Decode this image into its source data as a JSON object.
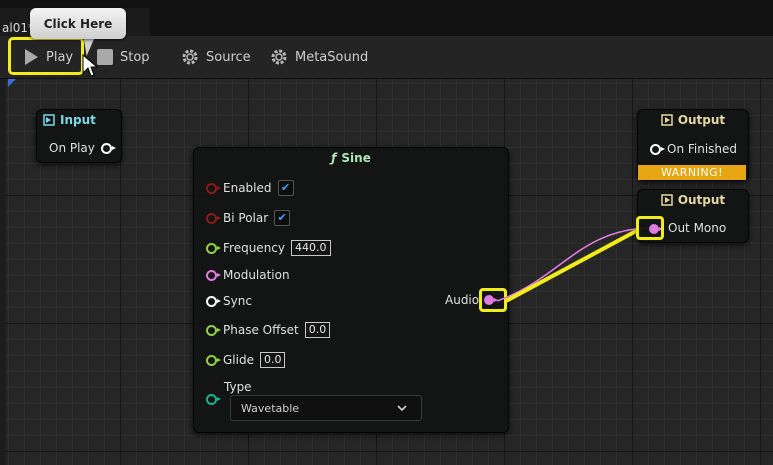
{
  "tab": {
    "title": "al01*"
  },
  "tooltip": {
    "text": "Click Here"
  },
  "toolbar": {
    "play": "Play",
    "stop": "Stop",
    "source": "Source",
    "metasound": "MetaSound"
  },
  "nodes": {
    "input": {
      "title": "Input",
      "pin": "On Play"
    },
    "sine": {
      "title": "Sine",
      "enabled": "Enabled",
      "bipolar": "Bi Polar",
      "frequency": "Frequency",
      "frequency_value": "440.0",
      "modulation": "Modulation",
      "sync": "Sync",
      "phase_offset": "Phase Offset",
      "phase_offset_value": "0.0",
      "glide": "Glide",
      "glide_value": "0.0",
      "type": "Type",
      "type_value": "Wavetable",
      "audio": "Audio"
    },
    "output_finished": {
      "title": "Output",
      "pin": "On Finished",
      "warning": "WARNING!"
    },
    "output_mono": {
      "title": "Output",
      "pin": "Out Mono"
    }
  },
  "colors": {
    "highlight": "#f2ec1a",
    "audio_pin": "#e07be0",
    "trigger_pin": "#ffffff",
    "float_pin": "#8fd14a",
    "bool_pin": "#8b1a1a",
    "enum_pin": "#1ab38c",
    "warning": "#e8a513"
  }
}
